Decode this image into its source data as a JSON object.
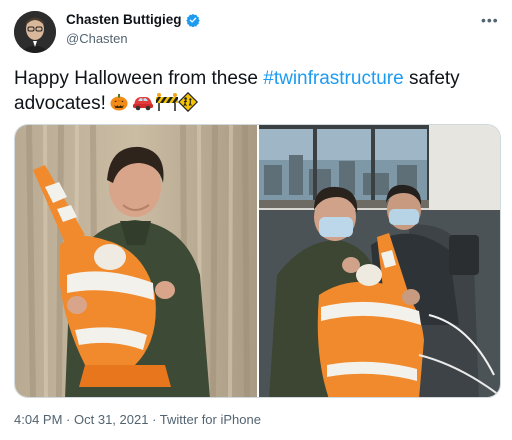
{
  "author": {
    "name": "Chasten Buttigieg",
    "handle": "@Chasten"
  },
  "tweet": {
    "text_prefix": "Happy Halloween from these ",
    "hashtag": "#twinfrastructure",
    "text_suffix": " safety advocates!",
    "emojis": [
      "jack-o-lantern-emoji",
      "car-emoji",
      "construction-barrier-emoji",
      "children-crossing-emoji"
    ]
  },
  "meta": {
    "time": "4:04 PM",
    "date": "Oct 31, 2021",
    "source": "Twitter for iPhone"
  },
  "colors": {
    "link": "#1d9bf0",
    "secondary": "#536471",
    "verified": "#1d9bf0"
  },
  "icons": [
    "more-options-icon",
    "verified-badge-icon"
  ]
}
